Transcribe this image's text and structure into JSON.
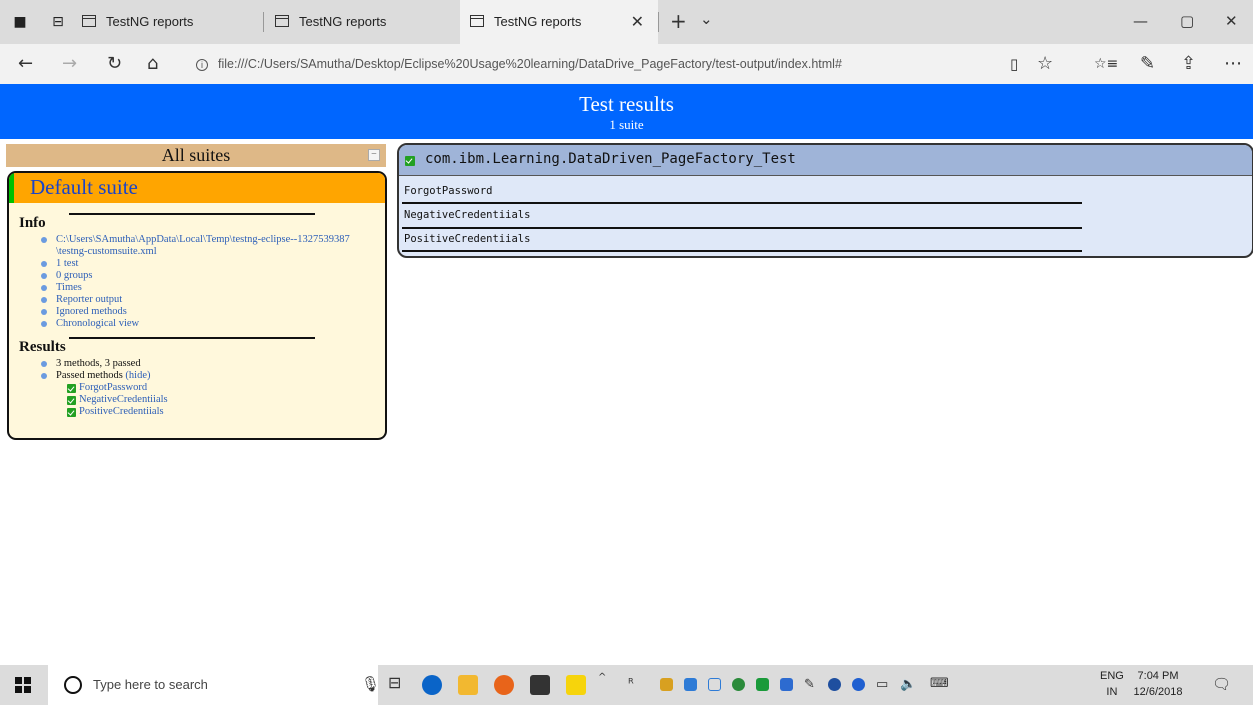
{
  "browser": {
    "tabs": [
      {
        "title": "TestNG reports",
        "active": false
      },
      {
        "title": "TestNG reports",
        "active": false
      },
      {
        "title": "TestNG reports",
        "active": true
      }
    ],
    "url": "file:///C:/Users/SAmutha/Desktop/Eclipse%20Usage%20learning/DataDrive_PageFactory/test-output/index.html#",
    "icons": {
      "set_aside": "set-aside-tabs-icon",
      "tab_preview": "tab-preview-icon",
      "new_tab": "+",
      "tab_list": "⌄",
      "minimize": "—",
      "restore": "▢",
      "close": "✕",
      "back": "←",
      "forward": "→",
      "refresh": "↻",
      "home": "⌂",
      "reading_view": "▯",
      "favorite": "☆",
      "favorites_hub": "☆≡",
      "pen": "✎",
      "share": "⇪",
      "more": "⋯"
    }
  },
  "report": {
    "header_title": "Test results",
    "header_subtitle": "1 suite",
    "all_suites_label": "All suites",
    "suite_name": "Default suite",
    "info_heading": "Info",
    "info_items": [
      "C:\\Users\\SAmutha\\AppData\\Local\\Temp\\testng-eclipse--1327539387",
      "\\testng-customsuite.xml",
      "1 test",
      "0 groups",
      "Times",
      "Reporter output",
      "Ignored methods",
      "Chronological view"
    ],
    "results_heading": "Results",
    "results_summary": "3 methods, 3 passed",
    "passed_methods_label": "Passed methods",
    "hide_link": "(hide)",
    "passed_methods": [
      "ForgotPassword",
      "NegativeCredentiials",
      "PositiveCredentiials"
    ],
    "test_class": "com.ibm.Learning.DataDriven_PageFactory_Test",
    "test_methods": [
      "ForgotPassword",
      "NegativeCredentiials",
      "PositiveCredentiials"
    ],
    "colors": {
      "header_bg": "#0066ff",
      "suite_header_bg": "#ffa500",
      "all_suites_bg": "#deb887",
      "suite_box_bg": "#fff8dc",
      "test_head_bg": "#9fb4d8",
      "test_box_bg": "#dfe8f8",
      "pass_green": "#22a022"
    }
  },
  "taskbar": {
    "search_placeholder": "Type here to search",
    "language_line1": "ENG",
    "language_line2": "IN",
    "time": "7:04 PM",
    "date": "12/6/2018"
  }
}
